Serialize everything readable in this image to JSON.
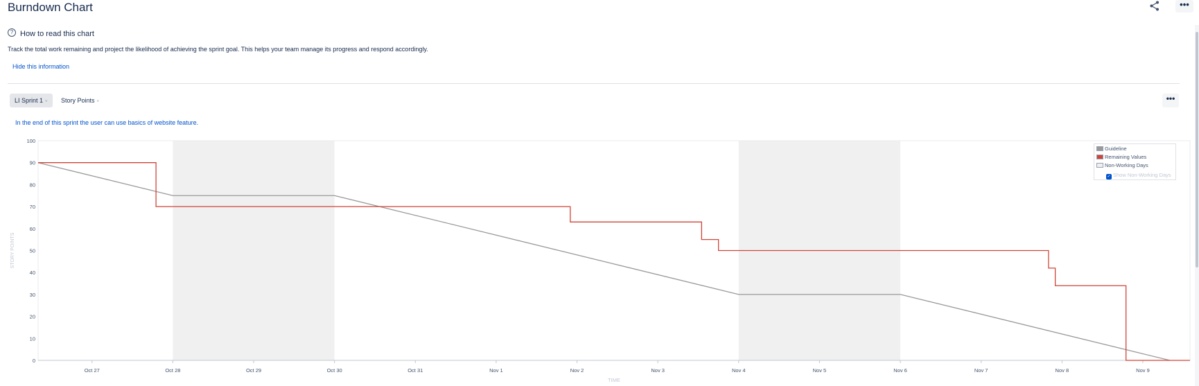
{
  "header": {
    "title": "Burndown Chart",
    "share_icon": "share-icon",
    "more_label": "•••"
  },
  "info": {
    "icon": "question-circle-icon",
    "icon_glyph": "?",
    "heading": "How to read this chart",
    "description": "Track the total work remaining and project the likelihood of achieving the sprint goal. This helps your team manage its progress and respond accordingly.",
    "hide_link": "Hide this information"
  },
  "controls": {
    "sprint": "LI Sprint 1",
    "metric": "Story Points",
    "caret": "˅",
    "more_label": "•••"
  },
  "sprint_goal": "In the end of this sprint the user can use basics of website feature.",
  "colors": {
    "guideline": "#999999",
    "remaining": "#d04437",
    "non_working": "#f0f0f0",
    "axis_text": "#42526e",
    "axis_title": "#c1c7d0",
    "grid_line": "#e9ebee"
  },
  "chart_data": {
    "type": "line",
    "xlabel": "TIME",
    "ylabel": "STORY POINTS",
    "ylim": [
      0,
      100
    ],
    "y_ticks": [
      0,
      10,
      20,
      30,
      40,
      50,
      60,
      70,
      80,
      90,
      100
    ],
    "x_range": [
      "Oct 26 08:00",
      "Nov 9 14:00"
    ],
    "x_ticks": [
      "Oct 27",
      "Oct 28",
      "Oct 29",
      "Oct 30",
      "Oct 31",
      "Nov 1",
      "Nov 2",
      "Nov 3",
      "Nov 4",
      "Nov 5",
      "Nov 6",
      "Nov 7",
      "Nov 8",
      "Nov 9"
    ],
    "non_working_days": [
      [
        "Oct 28 00:00",
        "Oct 30 00:00"
      ],
      [
        "Nov 4 00:00",
        "Nov 6 00:00"
      ]
    ],
    "series": [
      {
        "name": "Guideline",
        "points": [
          [
            "Oct 26 08:00",
            90
          ],
          [
            "Oct 28 00:00",
            75
          ],
          [
            "Oct 30 00:00",
            75
          ],
          [
            "Nov 4 00:00",
            30
          ],
          [
            "Nov 6 00:00",
            30
          ],
          [
            "Nov 9 08:00",
            0
          ]
        ]
      },
      {
        "name": "Remaining Values",
        "step": true,
        "points": [
          [
            "Oct 26 08:00",
            90
          ],
          [
            "Oct 27 19:00",
            90
          ],
          [
            "Oct 27 19:00",
            82
          ],
          [
            "Oct 27 19:00",
            70
          ],
          [
            "Nov 1 22:00",
            70
          ],
          [
            "Nov 1 22:00",
            63
          ],
          [
            "Nov 3 13:00",
            63
          ],
          [
            "Nov 3 13:00",
            55
          ],
          [
            "Nov 3 18:00",
            55
          ],
          [
            "Nov 3 18:00",
            50
          ],
          [
            "Nov 7 20:00",
            50
          ],
          [
            "Nov 7 20:00",
            42
          ],
          [
            "Nov 7 22:00",
            42
          ],
          [
            "Nov 7 22:00",
            34
          ],
          [
            "Nov 8 19:00",
            34
          ],
          [
            "Nov 8 19:00",
            0
          ],
          [
            "Nov 9 14:00",
            0
          ]
        ]
      }
    ],
    "legend": {
      "placement": "top-right",
      "entries": [
        "Guideline",
        "Remaining Values",
        "Non-Working Days"
      ],
      "checkbox_label": "Show Non-Working Days",
      "checkbox_checked": true,
      "checkbox_glyph": "✓"
    }
  }
}
